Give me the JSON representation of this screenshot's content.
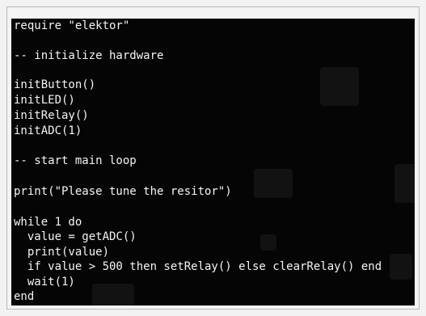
{
  "terminal": {
    "lines": [
      "require \"elektor\"",
      "",
      "-- initialize hardware",
      "",
      "initButton()",
      "initLED()",
      "initRelay()",
      "initADC(1)",
      "",
      "-- start main loop",
      "",
      "print(\"Please tune the resitor\")",
      "",
      "while 1 do",
      "  value = getADC()",
      "  print(value)",
      "  if value > 500 then setRelay() else clearRelay() end",
      "  wait(1)",
      "end"
    ]
  },
  "colors": {
    "terminal_background": "#050505",
    "terminal_text": "#f4f4f4",
    "outer_frame": "#f4f4f4",
    "frame_border": "#b8b8b8"
  }
}
